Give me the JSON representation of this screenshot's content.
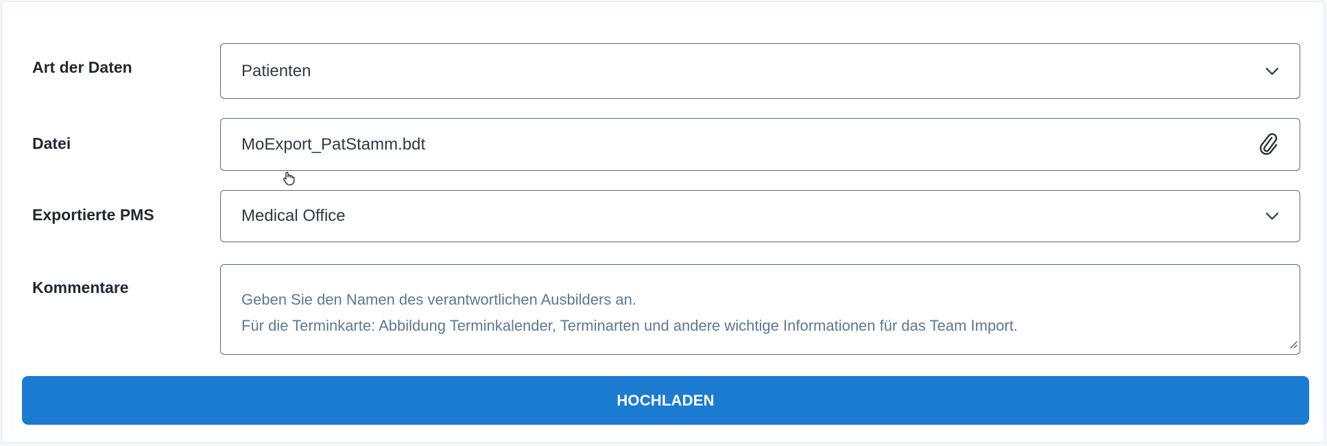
{
  "form": {
    "data_type": {
      "label": "Art der Daten",
      "value": "Patienten",
      "icon": "chevron-down-icon"
    },
    "file": {
      "label": "Datei",
      "value": "MoExport_PatStamm.bdt",
      "icon": "paperclip-icon"
    },
    "pms": {
      "label": "Exportierte PMS",
      "value": "Medical Office",
      "icon": "chevron-down-icon"
    },
    "comments": {
      "label": "Kommentare",
      "placeholder_lines": [
        "Geben Sie den Namen des verantwortlichen Ausbilders an.",
        "Für die Terminkarte: Abbildung Terminkalender, Terminarten und andere wichtige Informationen für das Team Import."
      ]
    },
    "submit_label": "HOCHLADEN"
  },
  "colors": {
    "accent": "#1b7bd0",
    "field_border": "#4d6c8f",
    "placeholder": "#5c7894",
    "label": "#222831"
  }
}
